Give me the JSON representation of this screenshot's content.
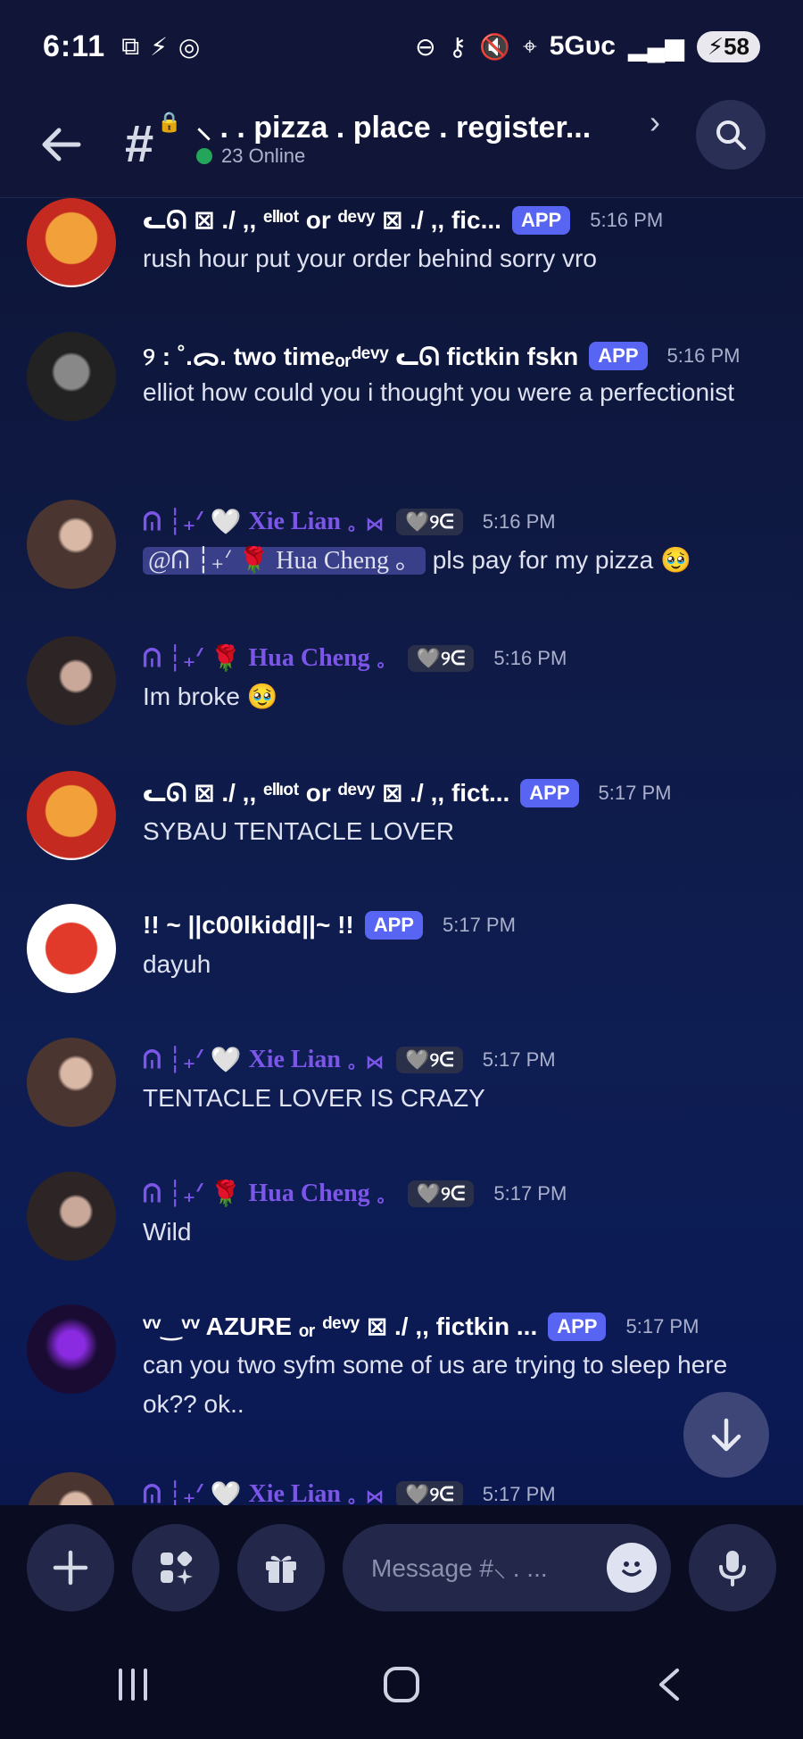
{
  "status": {
    "time": "6:11",
    "network": "5Gᴜᴄ",
    "battery": "58"
  },
  "header": {
    "channel_name": "⸜ . . pizza . place . register...",
    "online": "23 Online"
  },
  "messages": [
    {
      "name": "ᓚᘏ ⊠ ./ ,, ᵉˡˡᶦᵒᵗ or ᵈᵉᵛʸ ⊠ ./ ,, fic...",
      "badge": "APP",
      "time": "5:16 PM",
      "text": "rush hour put your order behind sorry vro"
    },
    {
      "name": "୨ : ˚.ᯅ. two timeₒᵣᵈᵉᵛʸ ᓚᘏ fictkin fskn",
      "badge": "APP",
      "time": "5:16 PM",
      "text": "elliot how could you i thought you were a perfectionist"
    },
    {
      "prefix": "ᕬ ┆₊ᐟ 🤍",
      "name": "Xie Lian",
      "suffix": "。⋈",
      "tag": "🩶୨ᕮ",
      "time": "5:16 PM",
      "mention": "@ᕬ ┆₊ᐟ 🌹 Hua Cheng 。",
      "text": " pls pay for my pizza 🥹"
    },
    {
      "prefix": "ᕬ ┆₊ᐟ 🌹",
      "name": "Hua Cheng",
      "suffix": "。",
      "tag": "🩶୨ᕮ",
      "time": "5:16 PM",
      "text": "Im broke 🥹"
    },
    {
      "name": "ᓚᘏ ⊠ ./ ,, ᵉˡˡᶦᵒᵗ or ᵈᵉᵛʸ ⊠ ./ ,, fict...",
      "badge": "APP",
      "time": "5:17 PM",
      "text": "SYBAU TENTACLE LOVER"
    },
    {
      "name": "!! ~ ||c00lkidd||~ !!",
      "badge": "APP",
      "time": "5:17 PM",
      "text": "dayuh"
    },
    {
      "prefix": "ᕬ ┆₊ᐟ 🤍",
      "name": "Xie Lian",
      "suffix": "。⋈",
      "tag": "🩶୨ᕮ",
      "time": "5:17 PM",
      "text": "TENTACLE LOVER IS CRAZY"
    },
    {
      "prefix": "ᕬ ┆₊ᐟ 🌹",
      "name": "Hua Cheng",
      "suffix": "。",
      "tag": "🩶୨ᕮ",
      "time": "5:17 PM",
      "text": "Wild"
    },
    {
      "name": "ᵛᵛ‿ᵛᵛ AZURE ₒᵣ ᵈᵉᵛʸ ⊠ ./ ,, fictkin ...",
      "badge": "APP",
      "time": "5:17 PM",
      "text": "can you two syfm some of us are trying to sleep here ok?? ok.."
    },
    {
      "prefix": "ᕬ ┆₊ᐟ 🤍",
      "name": "Xie Lian",
      "suffix": "。⋈",
      "tag": "🩶୨ᕮ",
      "time": "5:17 PM",
      "text": ""
    }
  ],
  "composer": {
    "placeholder": "Message #⸜ . ..."
  },
  "colors": {
    "accent": "#5865f2",
    "role": "#7b56e8",
    "online": "#23a55a"
  }
}
